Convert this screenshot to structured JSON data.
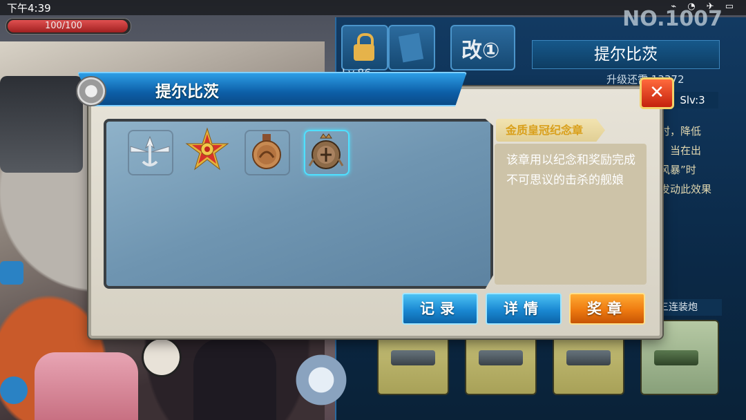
{
  "status_bar": {
    "time": "下午4:39"
  },
  "player": {
    "hp_text": "100/100"
  },
  "ship_panel": {
    "number": "NO.1007",
    "remodel_tab": "改①",
    "name": "提尔比茨",
    "level": "Lv.86",
    "upgrade_text": "升级还需 13372",
    "skill_level": "Slv:3",
    "skill_desc": "时，降低\n，当在出\n风暴”时\n发动此效果",
    "gun_label": "米三连装炮"
  },
  "modal": {
    "title": "提尔比茨",
    "close_icon": "✕",
    "medals": [
      {
        "icon": "wings-anchor-medal-icon",
        "selected": false
      },
      {
        "icon": "red-star-order-icon",
        "selected": false
      },
      {
        "icon": "bronze-coin-medal-icon",
        "selected": false
      },
      {
        "icon": "gold-crown-medal-icon",
        "selected": true
      }
    ],
    "selected_medal_name": "金质皇冠纪念章",
    "selected_medal_desc": "该章用以纪念和奖励完成不可思议的击杀的舰娘",
    "buttons": {
      "record": "记录",
      "details": "详情",
      "medals": "奖章"
    }
  },
  "colors": {
    "accent_blue": "#1a88d2",
    "accent_orange": "#ee7a10",
    "medal_name_gold": "#d9a01c"
  }
}
